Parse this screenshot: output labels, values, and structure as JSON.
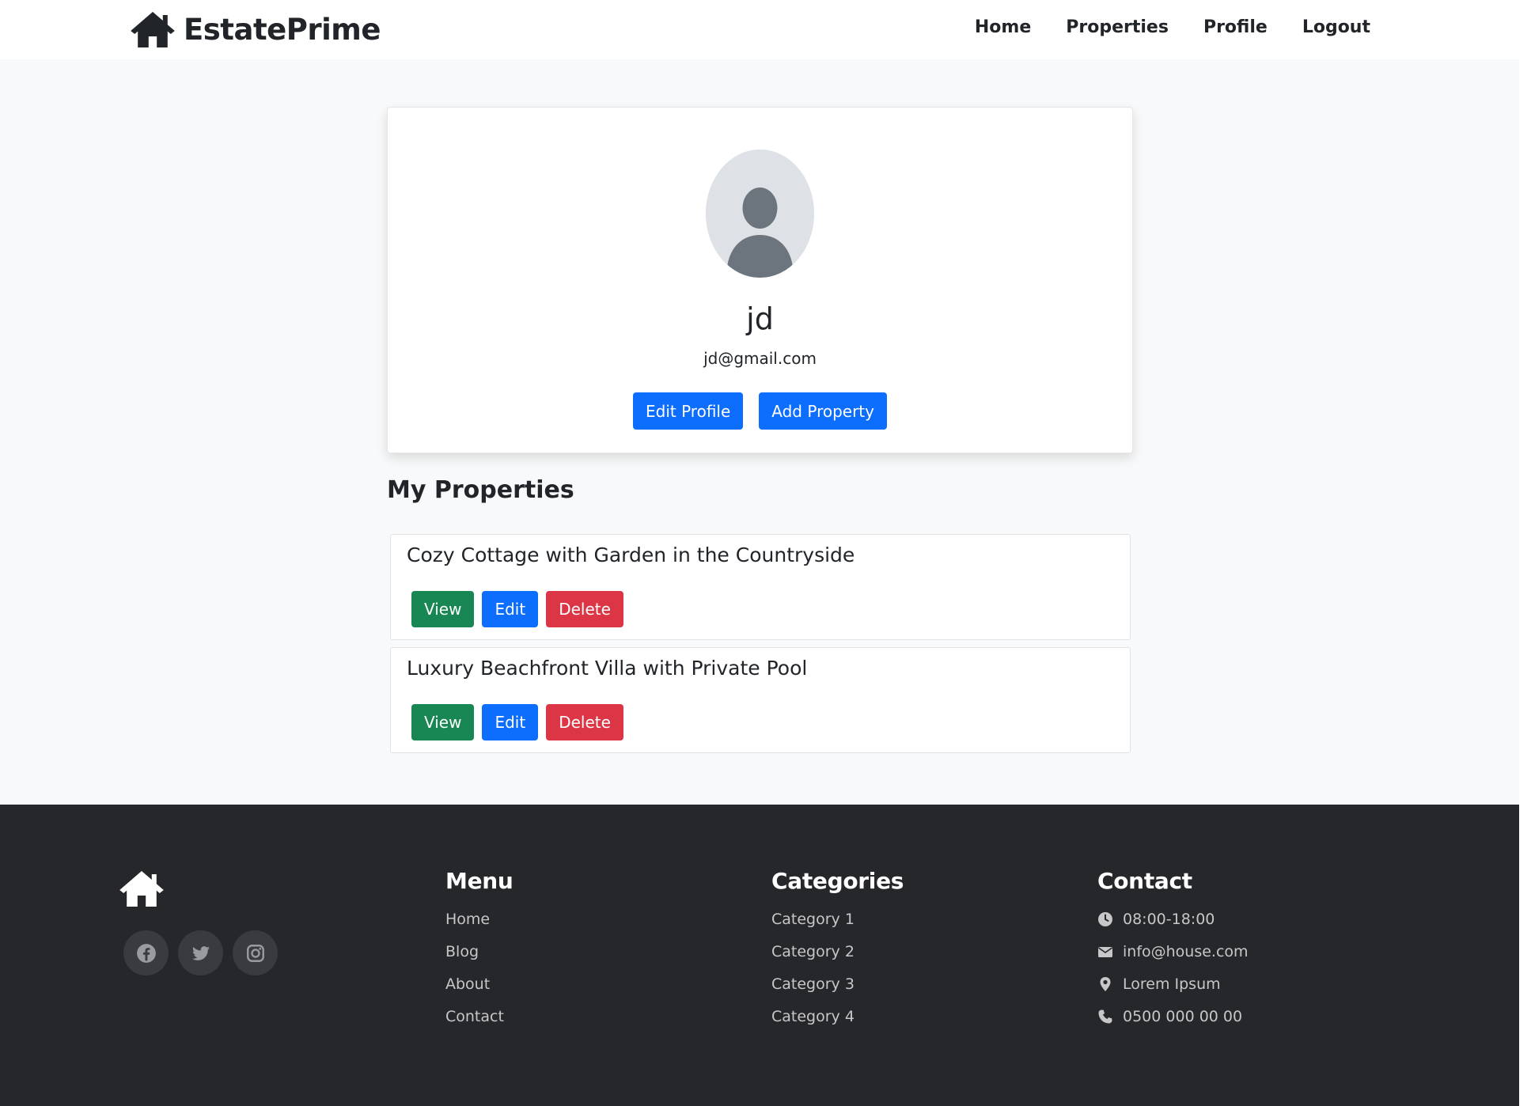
{
  "brand": {
    "name": "EstatePrime",
    "icon": "house-icon"
  },
  "nav": {
    "items": [
      {
        "label": "Home"
      },
      {
        "label": "Properties"
      },
      {
        "label": "Profile"
      },
      {
        "label": "Logout"
      }
    ]
  },
  "profile": {
    "avatar_icon": "user-avatar-icon",
    "username": "jd",
    "email": "jd@gmail.com",
    "edit_profile_label": "Edit Profile",
    "add_property_label": "Add Property"
  },
  "my_properties": {
    "title": "My Properties",
    "items": [
      {
        "title": "Cozy Cottage with Garden in the Countryside",
        "view_label": "View",
        "edit_label": "Edit",
        "delete_label": "Delete"
      },
      {
        "title": "Luxury Beachfront Villa with Private Pool",
        "view_label": "View",
        "edit_label": "Edit",
        "delete_label": "Delete"
      }
    ]
  },
  "footer": {
    "logo_icon": "house-icon",
    "socials": [
      {
        "icon": "facebook-icon"
      },
      {
        "icon": "twitter-icon"
      },
      {
        "icon": "instagram-icon"
      }
    ],
    "menu": {
      "title": "Menu",
      "items": [
        "Home",
        "Blog",
        "About",
        "Contact"
      ]
    },
    "categories": {
      "title": "Categories",
      "items": [
        "Category 1",
        "Category 2",
        "Category 3",
        "Category 4"
      ]
    },
    "contact": {
      "title": "Contact",
      "items": [
        {
          "icon": "clock-icon",
          "text": "08:00-18:00"
        },
        {
          "icon": "envelope-icon",
          "text": "info@house.com"
        },
        {
          "icon": "map-pin-icon",
          "text": "Lorem Ipsum"
        },
        {
          "icon": "phone-icon",
          "text": "0500 000 00 00"
        }
      ]
    }
  },
  "colors": {
    "primary": "#0d6efd",
    "success": "#198754",
    "danger": "#dc3545",
    "footer_bg": "#26272b",
    "page_bg": "#f8f9fa"
  }
}
